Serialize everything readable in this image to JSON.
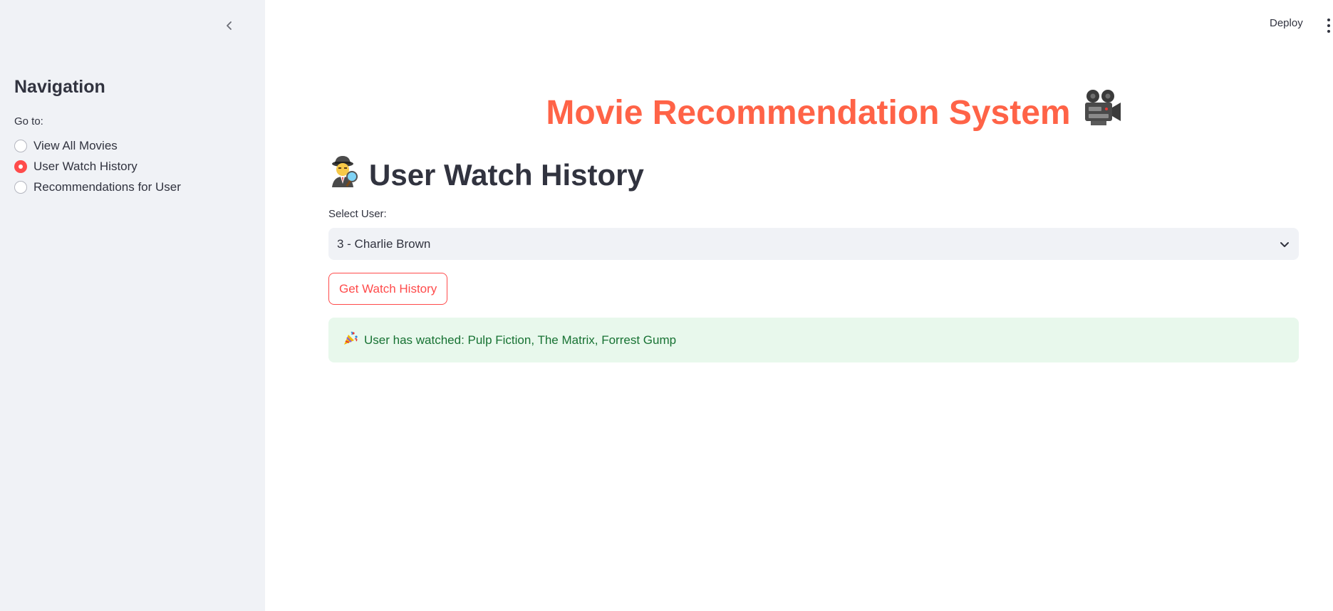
{
  "sidebar": {
    "title": "Navigation",
    "goto_label": "Go to:",
    "options": [
      {
        "label": "View All Movies",
        "selected": false
      },
      {
        "label": "User Watch History",
        "selected": true
      },
      {
        "label": "Recommendations for User",
        "selected": false
      }
    ]
  },
  "header": {
    "deploy_label": "Deploy",
    "menu_icon": "kebab-menu-icon"
  },
  "main": {
    "title": "Movie Recommendation System",
    "title_icon": "movie-camera-icon",
    "section_title": "User Watch History",
    "section_icon": "detective-icon",
    "select_label": "Select User:",
    "select_value": "3 - Charlie Brown",
    "button_label": "Get Watch History",
    "result_icon": "party-popper-icon",
    "result_text": "User has watched: Pulp Fiction, The Matrix, Forrest Gump"
  },
  "colors": {
    "accent": "#ff4b4b",
    "title": "#ff6347",
    "sidebar_bg": "#f0f2f6",
    "success_bg": "#e8f8ec",
    "success_text": "#177233"
  }
}
